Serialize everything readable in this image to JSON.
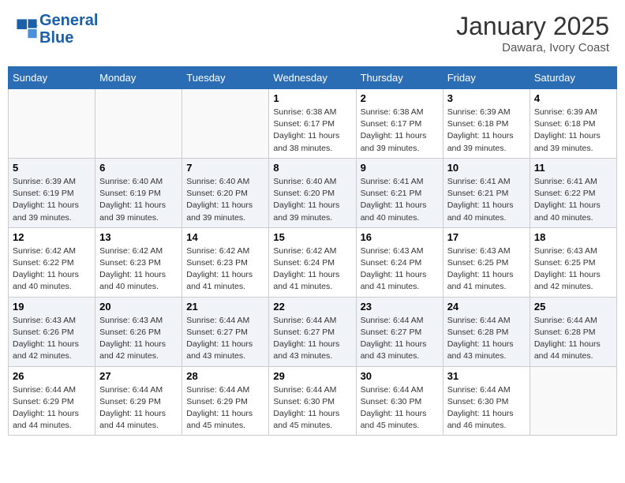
{
  "header": {
    "logo_line1": "General",
    "logo_line2": "Blue",
    "month": "January 2025",
    "location": "Dawara, Ivory Coast"
  },
  "weekdays": [
    "Sunday",
    "Monday",
    "Tuesday",
    "Wednesday",
    "Thursday",
    "Friday",
    "Saturday"
  ],
  "weeks": [
    [
      {
        "day": "",
        "info": ""
      },
      {
        "day": "",
        "info": ""
      },
      {
        "day": "",
        "info": ""
      },
      {
        "day": "1",
        "info": "Sunrise: 6:38 AM\nSunset: 6:17 PM\nDaylight: 11 hours\nand 38 minutes."
      },
      {
        "day": "2",
        "info": "Sunrise: 6:38 AM\nSunset: 6:17 PM\nDaylight: 11 hours\nand 39 minutes."
      },
      {
        "day": "3",
        "info": "Sunrise: 6:39 AM\nSunset: 6:18 PM\nDaylight: 11 hours\nand 39 minutes."
      },
      {
        "day": "4",
        "info": "Sunrise: 6:39 AM\nSunset: 6:18 PM\nDaylight: 11 hours\nand 39 minutes."
      }
    ],
    [
      {
        "day": "5",
        "info": "Sunrise: 6:39 AM\nSunset: 6:19 PM\nDaylight: 11 hours\nand 39 minutes."
      },
      {
        "day": "6",
        "info": "Sunrise: 6:40 AM\nSunset: 6:19 PM\nDaylight: 11 hours\nand 39 minutes."
      },
      {
        "day": "7",
        "info": "Sunrise: 6:40 AM\nSunset: 6:20 PM\nDaylight: 11 hours\nand 39 minutes."
      },
      {
        "day": "8",
        "info": "Sunrise: 6:40 AM\nSunset: 6:20 PM\nDaylight: 11 hours\nand 39 minutes."
      },
      {
        "day": "9",
        "info": "Sunrise: 6:41 AM\nSunset: 6:21 PM\nDaylight: 11 hours\nand 40 minutes."
      },
      {
        "day": "10",
        "info": "Sunrise: 6:41 AM\nSunset: 6:21 PM\nDaylight: 11 hours\nand 40 minutes."
      },
      {
        "day": "11",
        "info": "Sunrise: 6:41 AM\nSunset: 6:22 PM\nDaylight: 11 hours\nand 40 minutes."
      }
    ],
    [
      {
        "day": "12",
        "info": "Sunrise: 6:42 AM\nSunset: 6:22 PM\nDaylight: 11 hours\nand 40 minutes."
      },
      {
        "day": "13",
        "info": "Sunrise: 6:42 AM\nSunset: 6:23 PM\nDaylight: 11 hours\nand 40 minutes."
      },
      {
        "day": "14",
        "info": "Sunrise: 6:42 AM\nSunset: 6:23 PM\nDaylight: 11 hours\nand 41 minutes."
      },
      {
        "day": "15",
        "info": "Sunrise: 6:42 AM\nSunset: 6:24 PM\nDaylight: 11 hours\nand 41 minutes."
      },
      {
        "day": "16",
        "info": "Sunrise: 6:43 AM\nSunset: 6:24 PM\nDaylight: 11 hours\nand 41 minutes."
      },
      {
        "day": "17",
        "info": "Sunrise: 6:43 AM\nSunset: 6:25 PM\nDaylight: 11 hours\nand 41 minutes."
      },
      {
        "day": "18",
        "info": "Sunrise: 6:43 AM\nSunset: 6:25 PM\nDaylight: 11 hours\nand 42 minutes."
      }
    ],
    [
      {
        "day": "19",
        "info": "Sunrise: 6:43 AM\nSunset: 6:26 PM\nDaylight: 11 hours\nand 42 minutes."
      },
      {
        "day": "20",
        "info": "Sunrise: 6:43 AM\nSunset: 6:26 PM\nDaylight: 11 hours\nand 42 minutes."
      },
      {
        "day": "21",
        "info": "Sunrise: 6:44 AM\nSunset: 6:27 PM\nDaylight: 11 hours\nand 43 minutes."
      },
      {
        "day": "22",
        "info": "Sunrise: 6:44 AM\nSunset: 6:27 PM\nDaylight: 11 hours\nand 43 minutes."
      },
      {
        "day": "23",
        "info": "Sunrise: 6:44 AM\nSunset: 6:27 PM\nDaylight: 11 hours\nand 43 minutes."
      },
      {
        "day": "24",
        "info": "Sunrise: 6:44 AM\nSunset: 6:28 PM\nDaylight: 11 hours\nand 43 minutes."
      },
      {
        "day": "25",
        "info": "Sunrise: 6:44 AM\nSunset: 6:28 PM\nDaylight: 11 hours\nand 44 minutes."
      }
    ],
    [
      {
        "day": "26",
        "info": "Sunrise: 6:44 AM\nSunset: 6:29 PM\nDaylight: 11 hours\nand 44 minutes."
      },
      {
        "day": "27",
        "info": "Sunrise: 6:44 AM\nSunset: 6:29 PM\nDaylight: 11 hours\nand 44 minutes."
      },
      {
        "day": "28",
        "info": "Sunrise: 6:44 AM\nSunset: 6:29 PM\nDaylight: 11 hours\nand 45 minutes."
      },
      {
        "day": "29",
        "info": "Sunrise: 6:44 AM\nSunset: 6:30 PM\nDaylight: 11 hours\nand 45 minutes."
      },
      {
        "day": "30",
        "info": "Sunrise: 6:44 AM\nSunset: 6:30 PM\nDaylight: 11 hours\nand 45 minutes."
      },
      {
        "day": "31",
        "info": "Sunrise: 6:44 AM\nSunset: 6:30 PM\nDaylight: 11 hours\nand 46 minutes."
      },
      {
        "day": "",
        "info": ""
      }
    ]
  ]
}
